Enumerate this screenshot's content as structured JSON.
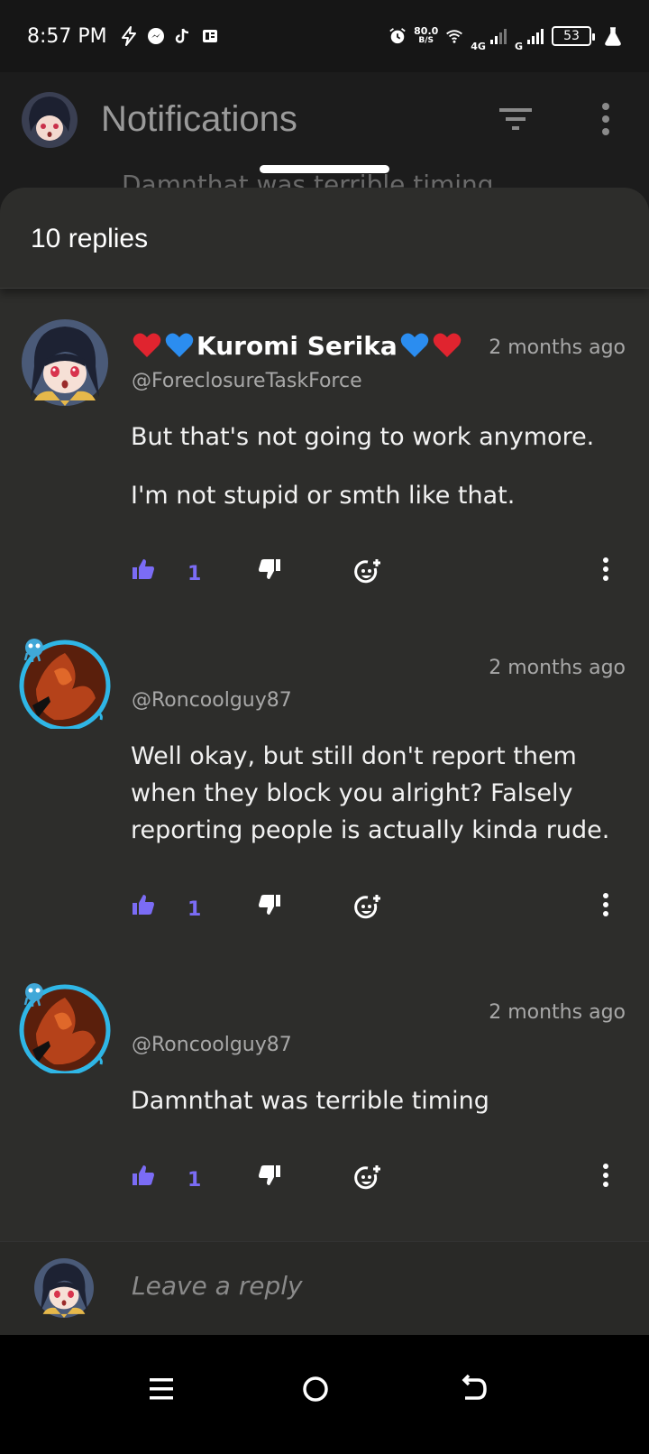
{
  "status_bar": {
    "time": "8:57 PM",
    "left_icons": [
      "bolt-icon",
      "messenger-icon",
      "tiktok-icon",
      "news-icon"
    ],
    "net_speed_value": "80.0",
    "net_speed_unit": "B/S",
    "network_1": "4G",
    "network_2": "G",
    "battery": "53"
  },
  "app_bar": {
    "title": "Notifications"
  },
  "behind_text": "Damnthat was terrible timing",
  "sheet": {
    "title": "10 replies"
  },
  "comments": [
    {
      "name": "Kuromi Serika",
      "handle": "@ForeclosureTaskForce",
      "time": "2 months ago",
      "body": [
        "But that's not going to work anymore.",
        "I'm not stupid or smth like that."
      ],
      "likes": "1"
    },
    {
      "name": "",
      "handle": "@Roncoolguy87",
      "time": "2 months ago",
      "body": [
        "Well okay, but still don't report them when they block you alright? Falsely reporting people is actually kinda rude."
      ],
      "likes": "1"
    },
    {
      "name": "",
      "handle": "@Roncoolguy87",
      "time": "2 months ago",
      "body": [
        "Damnthat was terrible timing"
      ],
      "likes": "1"
    }
  ],
  "reply_bar": {
    "placeholder": "Leave a reply"
  },
  "colors": {
    "accent": "#7b6cf5",
    "sheet_bg": "#2d2d2b",
    "heart_red": "#e0242f",
    "heart_blue": "#2b8df0"
  }
}
